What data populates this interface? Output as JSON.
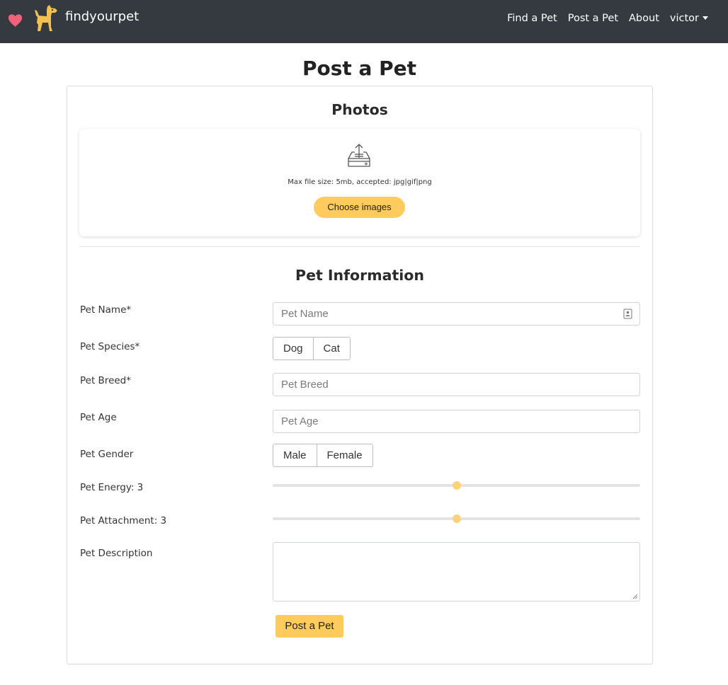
{
  "colors": {
    "navbar_bg": "#343a40",
    "accent": "#ffcb5c",
    "heart": "#f0627a",
    "slider_thumb": "#ffd27a"
  },
  "navbar": {
    "brand": "findyourpet",
    "heart_icon": "heart-icon",
    "logo_icon": "dog-icon",
    "links": [
      "Find a Pet",
      "Post a Pet",
      "About"
    ],
    "user": "victor"
  },
  "page": {
    "title": "Post a Pet"
  },
  "photos": {
    "title": "Photos",
    "icon": "inbox-upload-icon",
    "note": "Max file size: 5mb, accepted: jpg|gif|png",
    "choose_button": "Choose images"
  },
  "info": {
    "title": "Pet Information",
    "name": {
      "label": "Pet Name*",
      "placeholder": "Pet Name",
      "value": ""
    },
    "species": {
      "label": "Pet Species*",
      "options": [
        "Dog",
        "Cat"
      ]
    },
    "breed": {
      "label": "Pet Breed*",
      "placeholder": "Pet Breed",
      "value": ""
    },
    "age": {
      "label": "Pet Age",
      "placeholder": "Pet Age",
      "value": ""
    },
    "gender": {
      "label": "Pet Gender",
      "options": [
        "Male",
        "Female"
      ]
    },
    "energy": {
      "label": "Pet Energy: 3",
      "value": 3,
      "min": 1,
      "max": 5
    },
    "attachment": {
      "label": "Pet Attachment: 3",
      "value": 3,
      "min": 1,
      "max": 5
    },
    "description": {
      "label": "Pet Description",
      "value": ""
    },
    "submit": "Post a Pet"
  }
}
